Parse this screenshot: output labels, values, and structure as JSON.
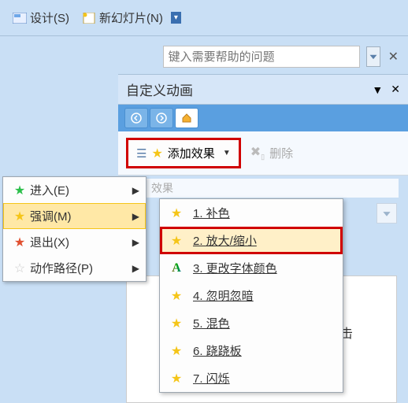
{
  "toolbar": {
    "design": "设计(S)",
    "new_slide": "新幻灯片(N)"
  },
  "help": {
    "placeholder": "键入需要帮助的问题"
  },
  "pane": {
    "title": "自定义动画"
  },
  "cmd": {
    "add_effect": "添加效果",
    "delete": "删除",
    "modify_row": "效果"
  },
  "submenu": {
    "enter": "进入(E)",
    "emphasis": "强调(M)",
    "exit": "退出(X)",
    "path": "动作路径(P)"
  },
  "flyout": {
    "i1": "1. 补色",
    "i2": "2. 放大/缩小",
    "i3": "3. 更改字体颜色",
    "i4": "4. 忽明忽暗",
    "i5": "5. 混色",
    "i6": "6. 跷跷板",
    "i7": "7. 闪烁"
  },
  "bg": {
    "hint": "后单击"
  }
}
